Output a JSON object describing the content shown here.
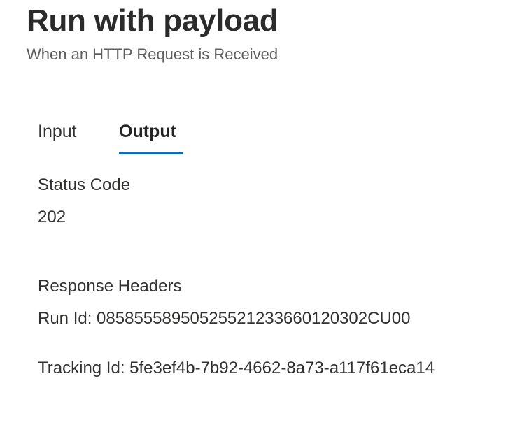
{
  "header": {
    "title": "Run with payload",
    "subtitle": "When an HTTP Request is Received"
  },
  "tabs": [
    {
      "label": "Input",
      "selected": false
    },
    {
      "label": "Output",
      "selected": true
    }
  ],
  "output": {
    "status_code_label": "Status Code",
    "status_code_value": "202",
    "response_headers_label": "Response Headers",
    "run_id_line": "Run Id: 08585558950525521233660120302CU00",
    "tracking_id_line": "Tracking Id: 5fe3ef4b-7b92-4662-8a73-a117f61eca14"
  },
  "colors": {
    "accent": "#0f6cbd",
    "text": "#323130",
    "subtitle": "#605e5c"
  }
}
